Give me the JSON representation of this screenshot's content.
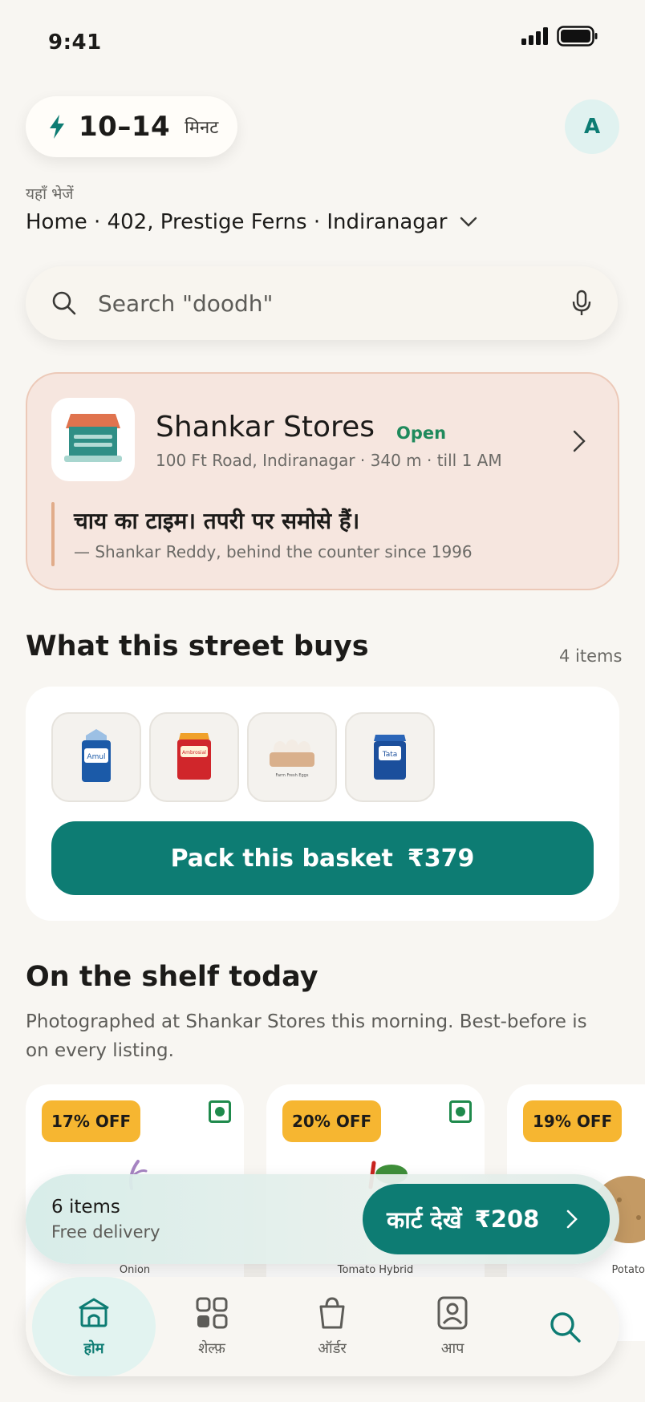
{
  "status_bar": {
    "time": "9:41"
  },
  "header": {
    "eta": {
      "time": "10–14",
      "unit": "मिनट"
    },
    "avatar_initial": "A",
    "deliver_label": "यहाँ भेजें",
    "address": "Home · 402, Prestige Ferns · Indiranagar"
  },
  "search": {
    "placeholder": "Search \"doodh\""
  },
  "store": {
    "name": "Shankar Stores",
    "status": "Open",
    "meta": "100 Ft Road, Indiranagar · 340 m · till 1 AM",
    "quote": "चाय का टाइम। तपरी पर समोसे हैं।",
    "quote_by": "— Shankar Reddy, behind the counter since 1996"
  },
  "street_buys": {
    "title": "What this street buys",
    "count": "4 items",
    "items": [
      {
        "label": "Amul",
        "icon": "milk-pack-icon",
        "color": "#1b5aa8"
      },
      {
        "label": "Ambrosial",
        "icon": "red-pack-icon",
        "color": "#d0262b"
      },
      {
        "label": "Farm Fresh Eggs",
        "icon": "eggs-tray-icon",
        "color": "#d9b08c"
      },
      {
        "label": "Tata",
        "icon": "salt-pack-icon",
        "color": "#1b4f9c"
      }
    ],
    "button_label": "Pack this basket",
    "button_price": "₹379"
  },
  "shelf": {
    "title": "On the shelf today",
    "subtitle": "Photographed at Shankar Stores this morning. Best-before is on every listing.",
    "products": [
      {
        "discount": "17% OFF",
        "name": "Onion"
      },
      {
        "discount": "20% OFF",
        "name": "Tomato Hybrid"
      },
      {
        "discount": "19% OFF",
        "name": "Potato"
      }
    ]
  },
  "cart": {
    "items": "6 items",
    "delivery": "Free delivery",
    "button_label": "कार्ट देखें",
    "button_price": "₹208"
  },
  "nav": {
    "items": [
      {
        "label": "होम",
        "icon": "home-icon"
      },
      {
        "label": "शेल्फ़",
        "icon": "grid-icon"
      },
      {
        "label": "ऑर्डर",
        "icon": "bag-icon"
      },
      {
        "label": "आप",
        "icon": "profile-icon"
      },
      {
        "label": "",
        "icon": "search-icon"
      }
    ]
  },
  "colors": {
    "accent": "#0d7c73",
    "badge": "#f6b631",
    "store_bg": "#f6e6df"
  }
}
